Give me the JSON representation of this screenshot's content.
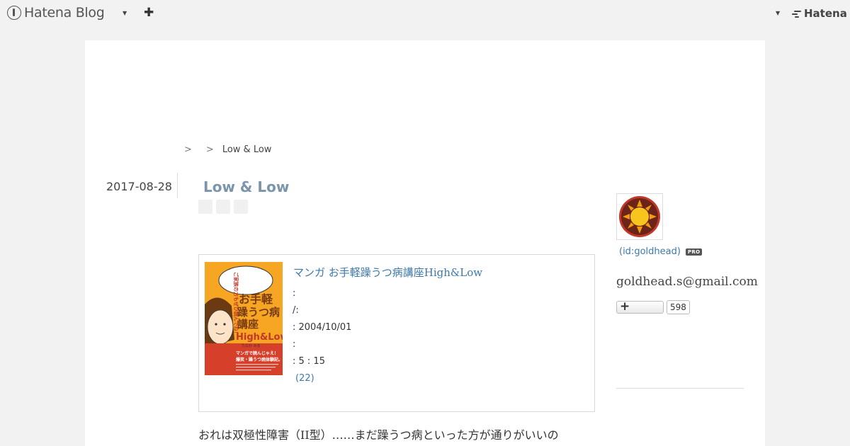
{
  "header": {
    "brand": "Hatena Blog",
    "right_brand": "Hatena"
  },
  "breadcrumb": {
    "sep1": ">",
    "sep2": ">",
    "current": "Low & Low"
  },
  "entry": {
    "date": "2017-08-28",
    "title": "Low & Low",
    "body_first_line": "おれは双極性障害（II型）……まだ躁うつ病といった方が通りがいいの"
  },
  "product": {
    "title": "マンガ お手軽躁うつ病講座High&Low",
    "rows": [
      ":",
      "/:",
      ":   2004/10/01",
      ":",
      ": 5   : 15"
    ],
    "reviews": "(22)",
    "cover": {
      "bubble_text": "ご家族の方もぜひ読んでね！",
      "title_lines": [
        "お手軽",
        "躁うつ病",
        "講座"
      ],
      "title_en": "High&Low",
      "author": "たなか みる",
      "tagline_1": "マンガで読んじゃえ！",
      "tagline_2": "爆笑・躁うつ病体験記。"
    }
  },
  "sidebar": {
    "profile_id": "(id:goldhead)",
    "pro_badge": "PRO",
    "email": "goldhead.s@gmail.com",
    "follow_count": "598"
  },
  "colors": {
    "link": "#3c79ad",
    "title": "#7a95ac",
    "background": "#f2f2f2"
  },
  "icons": {
    "logo": "hatena-blog-logo-icon",
    "plus": "plus-icon",
    "caret": "caret-down-icon",
    "avatar": "sun-avatar-icon"
  }
}
